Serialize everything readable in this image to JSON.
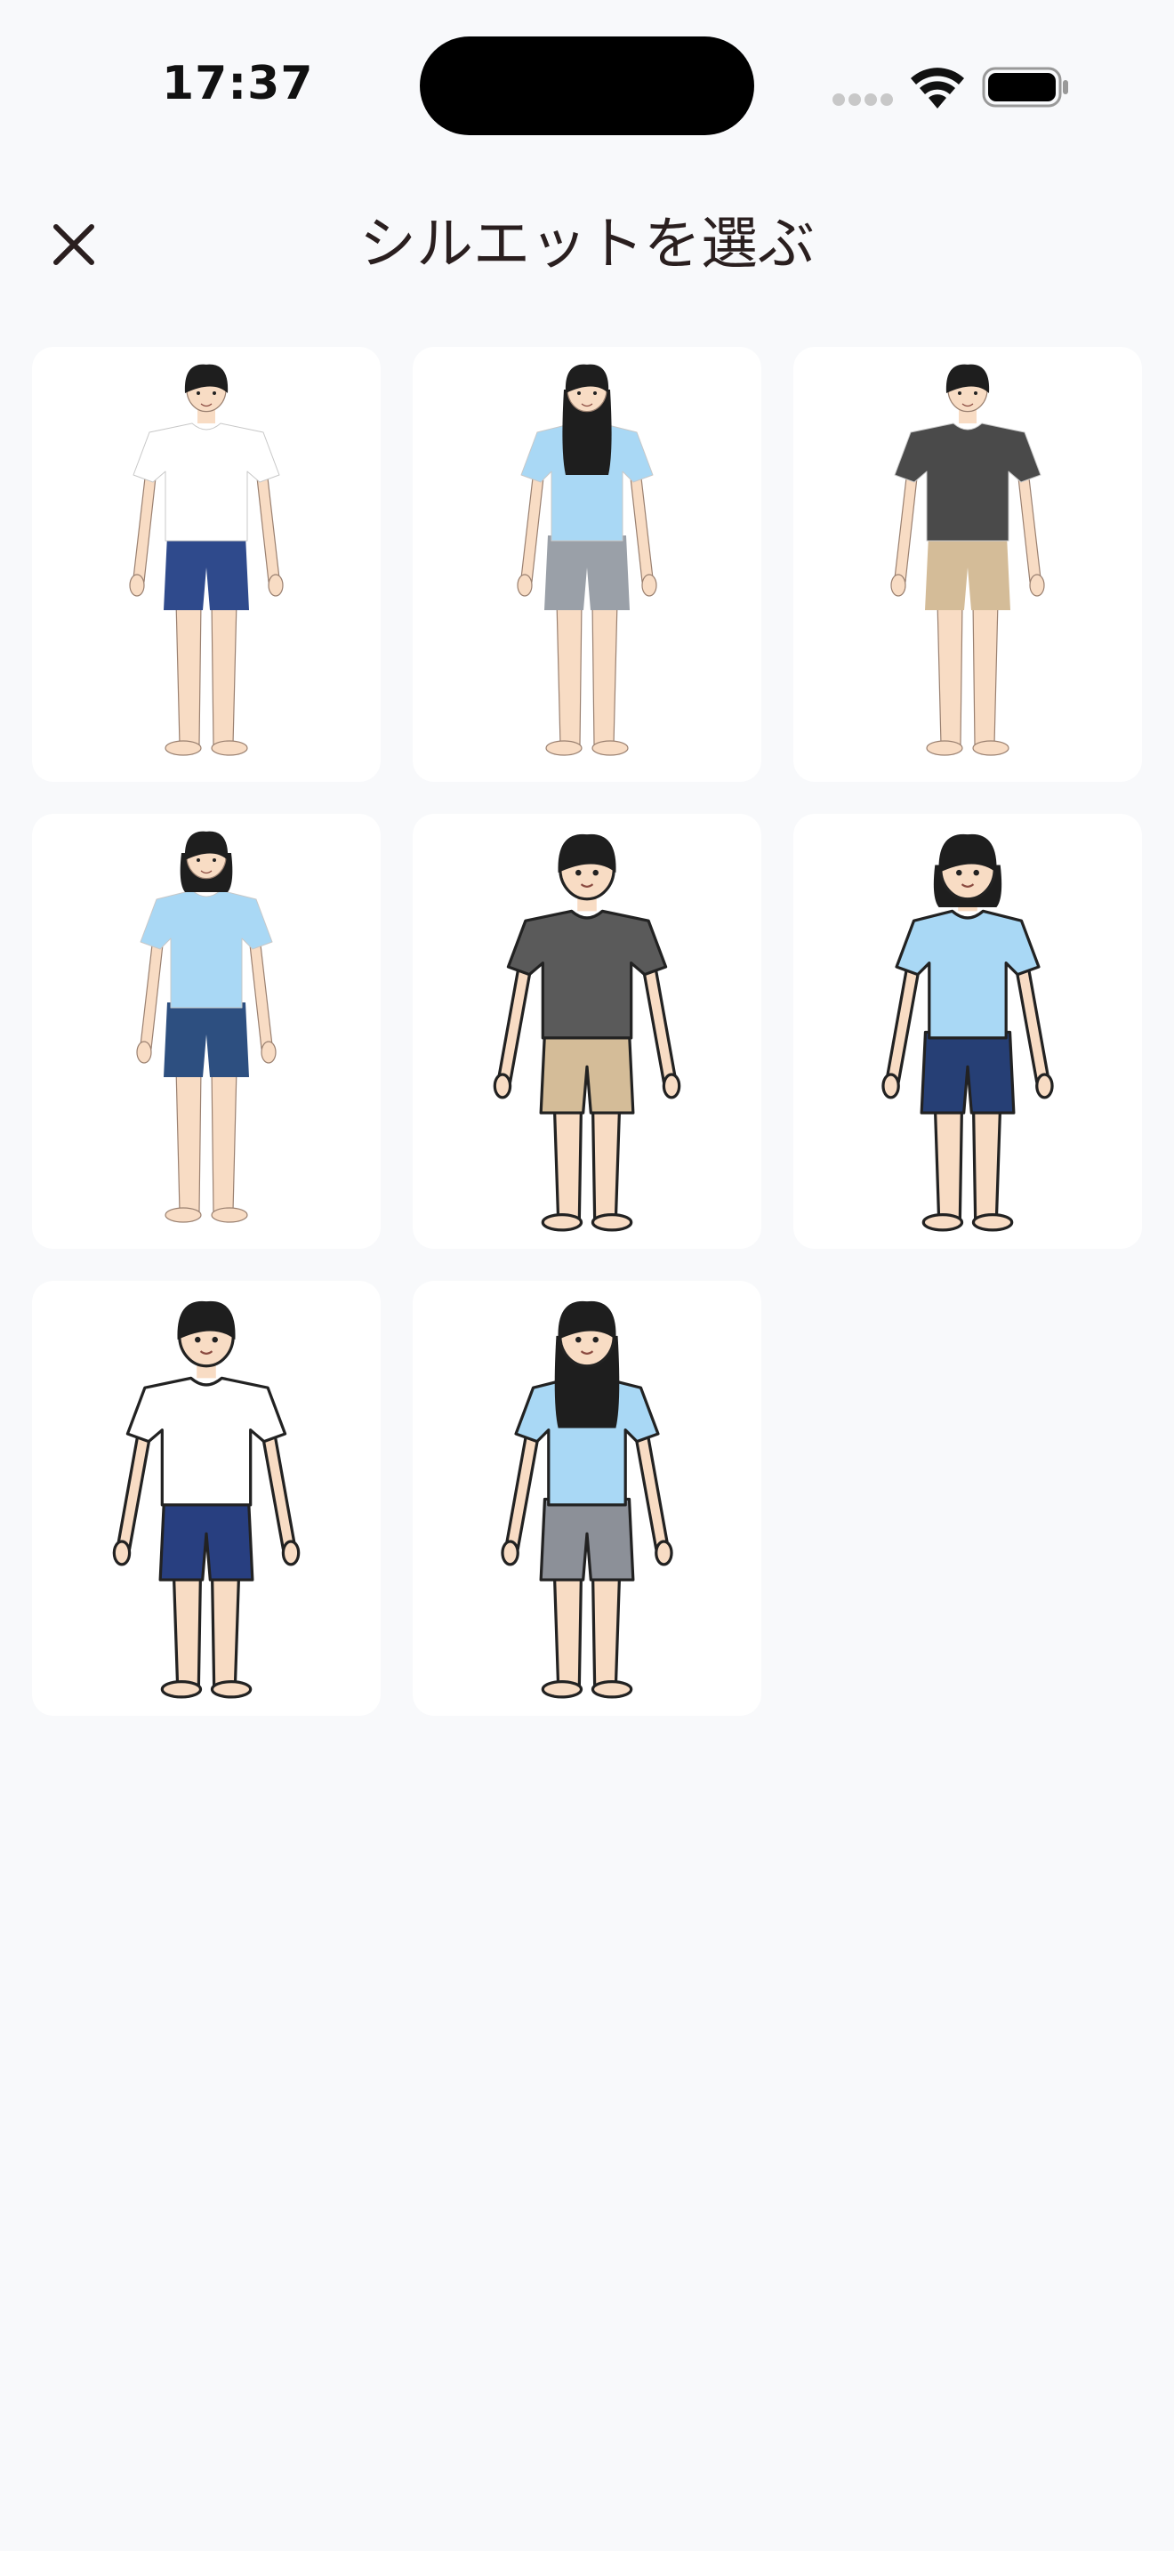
{
  "status_bar": {
    "time": "17:37",
    "icons": [
      "cellular-signal-icon",
      "wifi-icon",
      "battery-icon"
    ]
  },
  "header": {
    "title": "シルエットを選ぶ",
    "close_icon": "close-icon"
  },
  "silhouettes": [
    {
      "id": "silhouette-1",
      "style": "realistic",
      "gender": "male",
      "shirt": "#ffffff",
      "shorts": "#2f4a8c",
      "hair": "long-male"
    },
    {
      "id": "silhouette-2",
      "style": "realistic",
      "gender": "female",
      "shirt": "#a9d8f5",
      "shorts": "#9aa0a8",
      "hair": "long-female"
    },
    {
      "id": "silhouette-3",
      "style": "realistic",
      "gender": "male",
      "shirt": "#4a4a4a",
      "shorts": "#d4bc98",
      "hair": "short-male"
    },
    {
      "id": "silhouette-4",
      "style": "realistic",
      "gender": "female",
      "shirt": "#a9d8f5",
      "shorts": "#2d4f80",
      "hair": "bob-female"
    },
    {
      "id": "silhouette-5",
      "style": "cartoon",
      "gender": "male",
      "shirt": "#5a5a5a",
      "shorts": "#d4bc98",
      "hair": "short-male"
    },
    {
      "id": "silhouette-6",
      "style": "cartoon",
      "gender": "female",
      "shirt": "#a9d8f5",
      "shorts": "#263f75",
      "hair": "bob-female"
    },
    {
      "id": "silhouette-7",
      "style": "cartoon",
      "gender": "male",
      "shirt": "#ffffff",
      "shorts": "#283f80",
      "hair": "short-male"
    },
    {
      "id": "silhouette-8",
      "style": "cartoon",
      "gender": "female",
      "shirt": "#a9d8f5",
      "shorts": "#8c9098",
      "hair": "long-female"
    }
  ],
  "colors": {
    "background": "#f8f9fb",
    "card": "#ffffff",
    "title_text": "#2a1f1f",
    "skin": "#f8dcc4",
    "hair": "#1e1e1e"
  }
}
